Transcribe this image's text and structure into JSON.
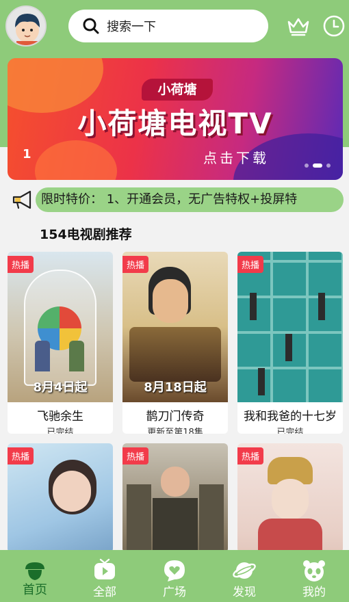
{
  "search": {
    "placeholder": "搜索一下"
  },
  "banner": {
    "brand": "小荷塘",
    "title": "小荷塘电视TV",
    "subtitle": "点击下载",
    "index": "1"
  },
  "notice": {
    "text": "限时特价： 1、开通会员，无广告特权+投屏特"
  },
  "section": {
    "title": "154电视剧推荐"
  },
  "shows": [
    {
      "badge": "热播",
      "title": "飞驰余生",
      "status": "已完结",
      "poster_text": "8月4日起"
    },
    {
      "badge": "热播",
      "title": "鹊刀门传奇",
      "status": "更新至第18集",
      "poster_text": "8月18日起"
    },
    {
      "badge": "热播",
      "title": "我和我爸的十七岁",
      "status": "已完结",
      "poster_text": ""
    },
    {
      "badge": "热播",
      "title": "",
      "status": "",
      "poster_text": ""
    },
    {
      "badge": "热播",
      "title": "",
      "status": "",
      "poster_text": ""
    },
    {
      "badge": "热播",
      "title": "",
      "status": "",
      "poster_text": ""
    }
  ],
  "nav": [
    {
      "label": "首页",
      "icon": "acorn-icon",
      "active": true
    },
    {
      "label": "全部",
      "icon": "tv-icon"
    },
    {
      "label": "广场",
      "icon": "chat-heart-icon"
    },
    {
      "label": "发现",
      "icon": "planet-icon"
    },
    {
      "label": "我的",
      "icon": "panda-icon"
    }
  ],
  "colors": {
    "brand_green": "#8ecb7a",
    "hot_badge": "#f23b4a",
    "active_nav": "#1b6e2a"
  }
}
